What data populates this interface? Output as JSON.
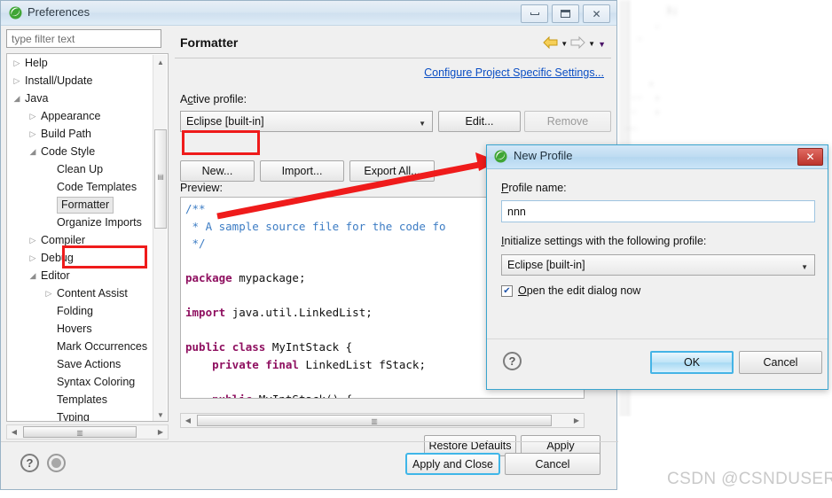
{
  "window": {
    "title": "Preferences",
    "icon": "eclipse-icon",
    "controls": {
      "minimize": "minimize-icon",
      "maximize": "maximize-icon",
      "close": "close-icon"
    }
  },
  "sidebar": {
    "filter": {
      "placeholder": "type filter text",
      "value": ""
    },
    "items": [
      {
        "label": "Help",
        "indent": 0,
        "arrow": "collapsed",
        "selected": false
      },
      {
        "label": "Install/Update",
        "indent": 0,
        "arrow": "collapsed",
        "selected": false
      },
      {
        "label": "Java",
        "indent": 0,
        "arrow": "expanded",
        "selected": false
      },
      {
        "label": "Appearance",
        "indent": 1,
        "arrow": "collapsed",
        "selected": false
      },
      {
        "label": "Build Path",
        "indent": 1,
        "arrow": "collapsed",
        "selected": false
      },
      {
        "label": "Code Style",
        "indent": 1,
        "arrow": "expanded",
        "selected": false
      },
      {
        "label": "Clean Up",
        "indent": 2,
        "arrow": "none",
        "selected": false
      },
      {
        "label": "Code Templates",
        "indent": 2,
        "arrow": "none",
        "selected": false
      },
      {
        "label": "Formatter",
        "indent": 2,
        "arrow": "none",
        "selected": true
      },
      {
        "label": "Organize Imports",
        "indent": 2,
        "arrow": "none",
        "selected": false
      },
      {
        "label": "Compiler",
        "indent": 1,
        "arrow": "collapsed",
        "selected": false
      },
      {
        "label": "Debug",
        "indent": 1,
        "arrow": "collapsed",
        "selected": false
      },
      {
        "label": "Editor",
        "indent": 1,
        "arrow": "expanded",
        "selected": false
      },
      {
        "label": "Content Assist",
        "indent": 2,
        "arrow": "collapsed",
        "selected": false
      },
      {
        "label": "Folding",
        "indent": 2,
        "arrow": "none",
        "selected": false
      },
      {
        "label": "Hovers",
        "indent": 2,
        "arrow": "none",
        "selected": false
      },
      {
        "label": "Mark Occurrences",
        "indent": 2,
        "arrow": "none",
        "selected": false
      },
      {
        "label": "Save Actions",
        "indent": 2,
        "arrow": "none",
        "selected": false
      },
      {
        "label": "Syntax Coloring",
        "indent": 2,
        "arrow": "none",
        "selected": false
      },
      {
        "label": "Templates",
        "indent": 2,
        "arrow": "none",
        "selected": false
      },
      {
        "label": "Typing",
        "indent": 2,
        "arrow": "none",
        "selected": false
      }
    ]
  },
  "content": {
    "title": "Formatter",
    "nav": {
      "back": "back-arrow-icon",
      "forward": "forward-arrow-icon",
      "menu": "view-menu-icon"
    },
    "config_link": "Configure Project Specific Settings...",
    "active_profile_label": "Active profile:",
    "active_profile_value": "Eclipse [built-in]",
    "buttons": {
      "edit": "Edit...",
      "remove": "Remove",
      "new": "New...",
      "import": "Import...",
      "export_all": "Export All..."
    },
    "preview_label": "Preview:",
    "code_lines": [
      {
        "text": "/**",
        "cls": "c-cmt"
      },
      {
        "text": " * A sample source file for the code fo",
        "cls": "c-cmt"
      },
      {
        "text": " */",
        "cls": "c-cmt"
      },
      {
        "text": "",
        "cls": ""
      },
      {
        "text": "package mypackage;",
        "cls": "kw1"
      },
      {
        "text": "",
        "cls": ""
      },
      {
        "text": "import java.util.LinkedList;",
        "cls": "kw1"
      },
      {
        "text": "",
        "cls": ""
      },
      {
        "text": "public class MyIntStack {",
        "cls": "kw2"
      },
      {
        "text": "    private final LinkedList fStack;",
        "cls": "kw3"
      },
      {
        "text": "",
        "cls": ""
      },
      {
        "text": "    public MyIntStack() {",
        "cls": "kw4"
      }
    ],
    "footer_buttons": {
      "restore_defaults": "Restore Defaults",
      "apply": "Apply"
    }
  },
  "footer": {
    "help_icon": "help-icon",
    "secondary_icon": "filter-toggle-icon",
    "apply_and_close": "Apply and Close",
    "cancel": "Cancel"
  },
  "dialog": {
    "title": "New Profile",
    "icon": "eclipse-icon",
    "close": "close-icon",
    "profile_name_label": "Profile name:",
    "profile_name_value": "nnn",
    "init_label": "Initialize settings with the following profile:",
    "init_value": "Eclipse [built-in]",
    "checkbox_label": "Open the edit dialog now",
    "checkbox_checked": true,
    "help_icon": "help-icon",
    "ok": "OK",
    "cancel": "Cancel"
  },
  "annotation": {
    "highlight_color": "#ef1b1b",
    "arrow": "red-arrow-pointing-to-profile-name-field"
  },
  "watermark": {
    "text": "CSDN @CSNDUSER"
  },
  "background": {
    "blurred_code": "        );\n      .\n   -\n\n\n     ,\n  ..  ,\n  .   ,\n __"
  }
}
